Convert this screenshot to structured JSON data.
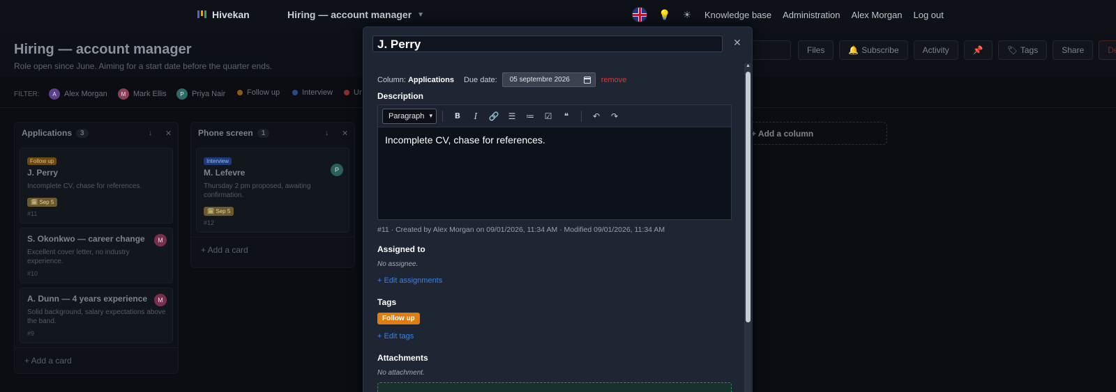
{
  "nav": {
    "app_name": "Hivekan",
    "board_name": "Hiring — account manager",
    "links": [
      "Knowledge base",
      "Administration",
      "Alex Morgan",
      "Log out"
    ],
    "icons": [
      "uk-flag-icon",
      "lightbulb-icon",
      "sun-icon"
    ]
  },
  "header": {
    "title": "Hiring — account manager",
    "subtitle": "Role open since June. Aiming for a start date before the quarter ends.",
    "actions": {
      "files": "Files",
      "subscribe": "Subscribe",
      "activity": "Activity",
      "tags": "Tags",
      "share": "Share",
      "delete": "Delete"
    }
  },
  "filter": {
    "label": "FILTER:",
    "chips": [
      {
        "label": "Alex Morgan",
        "initial": "A",
        "color": "#5b3f8c"
      },
      {
        "label": "Mark Ellis",
        "initial": "M",
        "color": "#8c3f5a"
      },
      {
        "label": "Priya Nair",
        "initial": "P",
        "color": "#2f6b66"
      },
      {
        "label": "Follow up",
        "color": "#e07d12"
      },
      {
        "label": "Interview",
        "color": "#3a63c4"
      },
      {
        "label": "Ur",
        "color": "#c43a3a"
      }
    ]
  },
  "columns": [
    {
      "name": "Applications",
      "count": "3",
      "cards": [
        {
          "tag": "Follow up",
          "title": "J. Perry",
          "desc": "Incomplete CV, chase for references.",
          "due": "🗓 Sep 5",
          "id": "#11"
        },
        {
          "title": "S. Okonkwo — career change",
          "desc": "Excellent cover letter, no industry experience.",
          "id": "#10",
          "avatar": "M"
        },
        {
          "title": "A. Dunn — 4 years experience",
          "desc": "Solid background, salary expectations above the band.",
          "id": "#9",
          "avatar": "M"
        }
      ],
      "add_label": "+ Add a card"
    },
    {
      "name": "Phone screen",
      "count": "1",
      "cards": [
        {
          "tag": "Interview",
          "title": "M. Lefevre",
          "desc": "Thursday 2 pm proposed, awaiting confirmation.",
          "due": "🗓 Sep 5",
          "id": "#12",
          "avatar": "P"
        }
      ],
      "add_label": "+ Add a card"
    }
  ],
  "add_column_label": "+ Add a column",
  "modal": {
    "title": "J. Perry",
    "column_label": "Column:",
    "column_value": "Applications",
    "due_label": "Due date:",
    "due_value": "05 septembre 2026",
    "remove_label": "remove",
    "description_heading": "Description",
    "paragraph_select": "Paragraph",
    "description_text": "Incomplete CV, chase for references.",
    "info_line": "#11 · Created by Alex Morgan on 09/01/2026, 11:34 AM · Modified 09/01/2026, 11:34 AM",
    "assigned_heading": "Assigned to",
    "no_assignee": "No assignee.",
    "edit_assignments": "+ Edit assignments",
    "tags_heading": "Tags",
    "tag": "Follow up",
    "edit_tags": "+ Edit tags",
    "attachments_heading": "Attachments",
    "no_attachment": "No attachment."
  },
  "colors": {
    "accent_orange": "#e07d12",
    "link_blue": "#3d82e0",
    "danger_red": "#d33b3b"
  }
}
